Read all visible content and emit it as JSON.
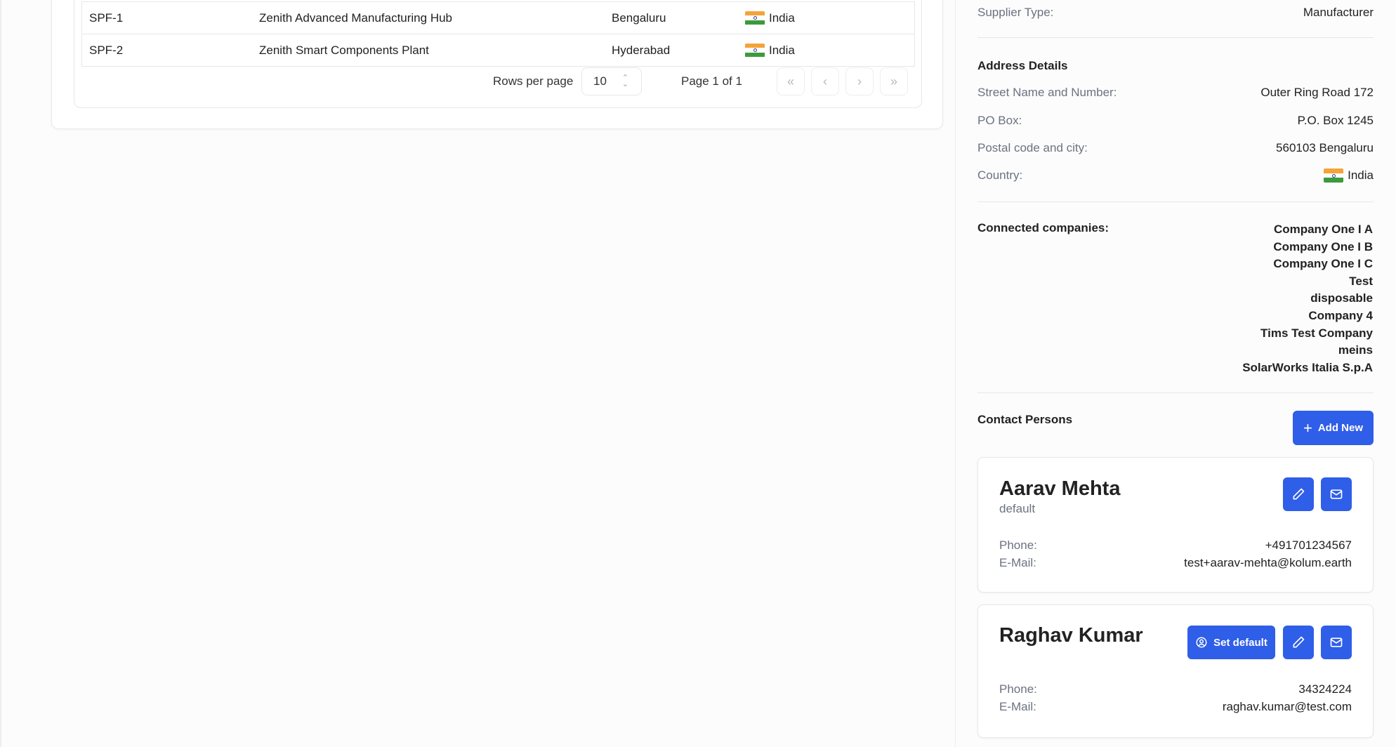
{
  "table": {
    "rows": [
      {
        "id": "SPF-1",
        "name": "Zenith Advanced Manufacturing Hub",
        "city": "Bengaluru",
        "country": "India"
      },
      {
        "id": "SPF-2",
        "name": "Zenith Smart Components Plant",
        "city": "Hyderabad",
        "country": "India"
      }
    ]
  },
  "pagination": {
    "rows_per_page_label": "Rows per page",
    "rows_per_page_value": "10",
    "page_info": "Page 1 of 1",
    "first": "«",
    "prev": "‹",
    "next": "›",
    "last": "»"
  },
  "supplier": {
    "type_label": "Supplier Type:",
    "type_value": "Manufacturer"
  },
  "address": {
    "title": "Address Details",
    "street_label": "Street Name and Number:",
    "street_value": "Outer Ring Road 172",
    "pobox_label": "PO Box:",
    "pobox_value": "P.O. Box 1245",
    "postal_label": "Postal code and city:",
    "postal_value": "560103 Bengaluru",
    "country_label": "Country:",
    "country_value": "India"
  },
  "connected": {
    "label": "Connected companies:",
    "companies": [
      "Company One I A",
      "Company One I B",
      "Company One I C",
      "Test",
      "disposable",
      "Company 4",
      "Tims Test Company",
      "meins",
      "SolarWorks Italia S.p.A"
    ]
  },
  "contacts": {
    "title": "Contact Persons",
    "add_label": "Add New",
    "set_default_label": "Set default",
    "phone_label": "Phone:",
    "email_label": "E-Mail:",
    "people": [
      {
        "name": "Aarav Mehta",
        "subtitle": "default",
        "phone": "+491701234567",
        "email": "test+aarav-mehta@kolum.earth"
      },
      {
        "name": "Raghav Kumar",
        "subtitle": "",
        "phone": "34324224",
        "email": "raghav.kumar@test.com"
      }
    ]
  },
  "colors": {
    "primary": "#2f5ee8",
    "border": "#e5e7eb",
    "muted_text": "#6b7280"
  }
}
